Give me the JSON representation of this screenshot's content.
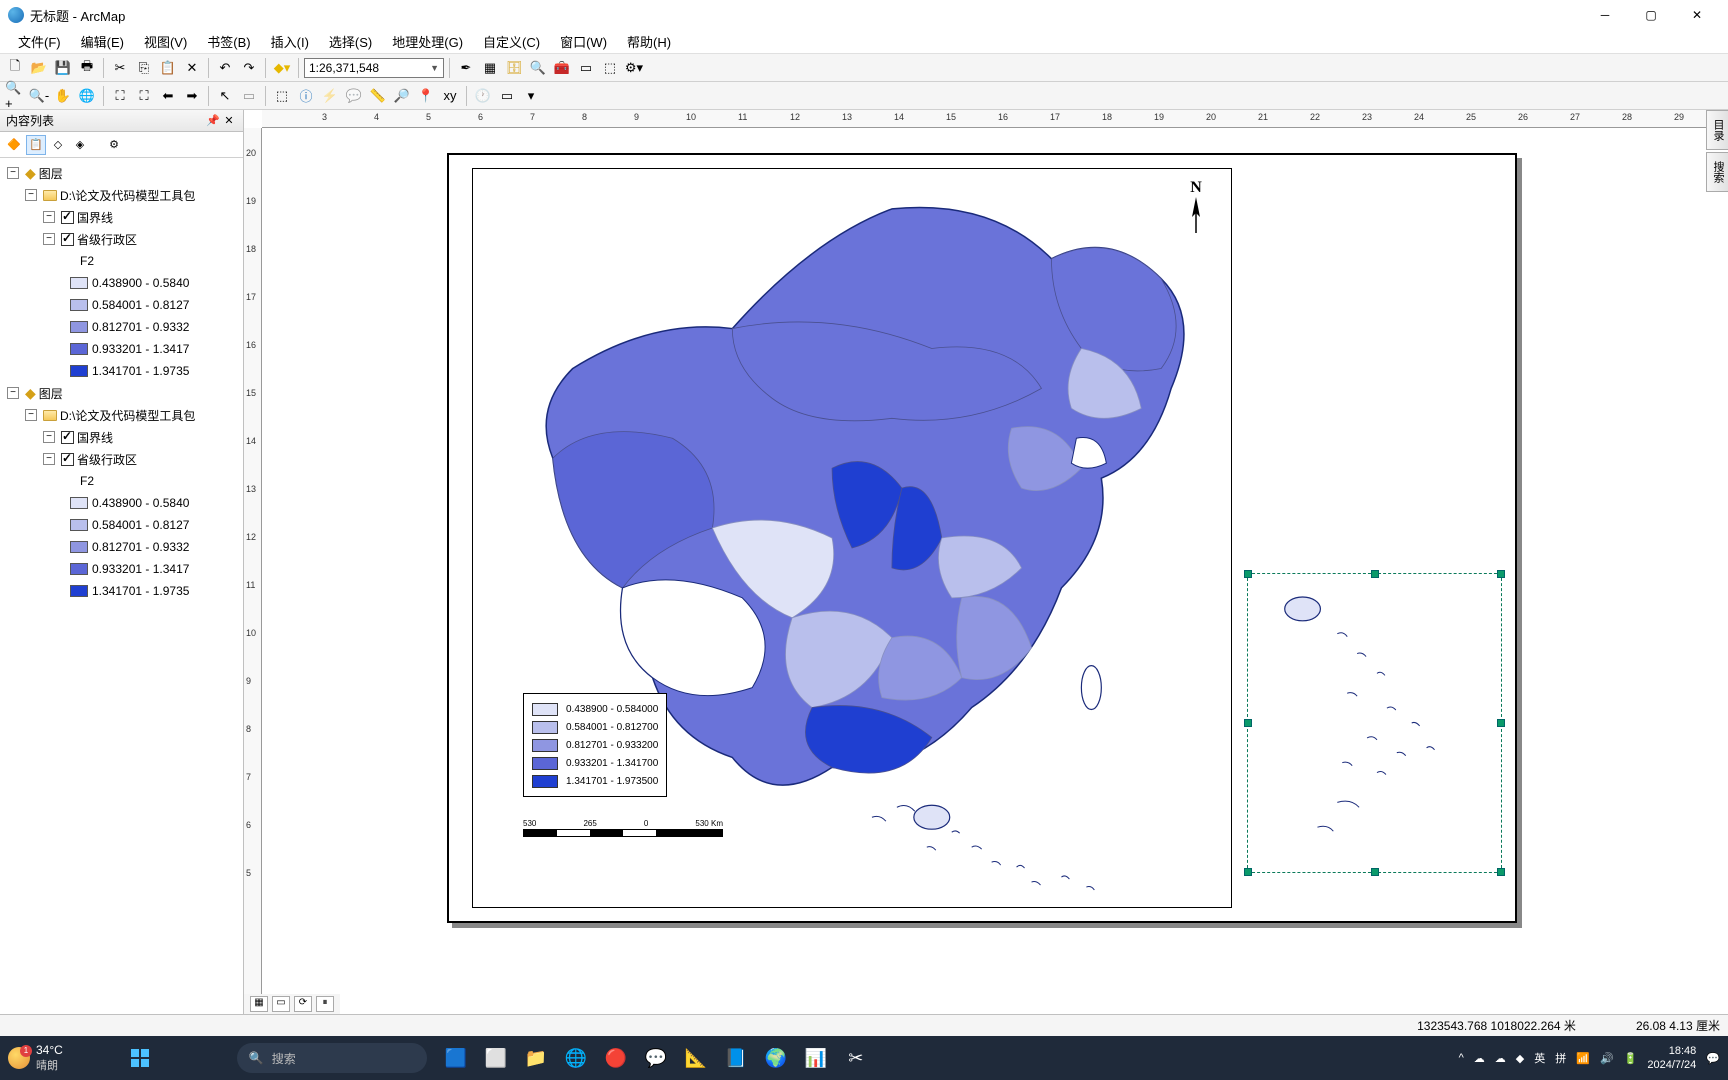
{
  "window": {
    "title": "无标题 - ArcMap"
  },
  "menu": {
    "file": "文件(F)",
    "edit": "编辑(E)",
    "view": "视图(V)",
    "bookmarks": "书签(B)",
    "insert": "插入(I)",
    "select": "选择(S)",
    "geoproc": "地理处理(G)",
    "customize": "自定义(C)",
    "window": "窗口(W)",
    "help": "帮助(H)"
  },
  "toolbar": {
    "scale": "1:26,371,548"
  },
  "toc": {
    "title": "内容列表",
    "groups": [
      {
        "group_label": "图层",
        "dataframe": "D:\\论文及代码模型工具包",
        "layers": [
          {
            "name": "国界线",
            "checked": true
          },
          {
            "name": "省级行政区",
            "checked": true,
            "field": "F2",
            "classes": [
              {
                "color": "#dfe3f7",
                "label": "0.438900 - 0.5840"
              },
              {
                "color": "#b9bfec",
                "label": "0.584001 - 0.8127"
              },
              {
                "color": "#8f96e1",
                "label": "0.812701 - 0.9332"
              },
              {
                "color": "#5b66d6",
                "label": "0.933201 - 1.3417"
              },
              {
                "color": "#1f3fd1",
                "label": "1.341701 - 1.9735"
              }
            ]
          }
        ]
      },
      {
        "group_label": "图层",
        "dataframe": "D:\\论文及代码模型工具包",
        "layers": [
          {
            "name": "国界线",
            "checked": true
          },
          {
            "name": "省级行政区",
            "checked": true,
            "field": "F2",
            "classes": [
              {
                "color": "#dfe3f7",
                "label": "0.438900 - 0.5840"
              },
              {
                "color": "#b9bfec",
                "label": "0.584001 - 0.8127"
              },
              {
                "color": "#8f96e1",
                "label": "0.812701 - 0.9332"
              },
              {
                "color": "#5b66d6",
                "label": "0.933201 - 1.3417"
              },
              {
                "color": "#1f3fd1",
                "label": "1.341701 - 1.9735"
              }
            ]
          }
        ]
      }
    ]
  },
  "legend": {
    "rows": [
      {
        "color": "#dfe3f7",
        "label": "0.438900 - 0.584000"
      },
      {
        "color": "#b9bfec",
        "label": "0.584001 - 0.812700"
      },
      {
        "color": "#8f96e1",
        "label": "0.812701 - 0.933200"
      },
      {
        "color": "#5b66d6",
        "label": "0.933201 - 1.341700"
      },
      {
        "color": "#1f3fd1",
        "label": "1.341701 - 1.973500"
      }
    ]
  },
  "north": {
    "label": "N"
  },
  "scalebar": {
    "l0": "530",
    "l1": "265",
    "l2": "0",
    "l3": "530 Km"
  },
  "status": {
    "coords": "1323543.768  1018022.264 米",
    "page": "26.08  4.13 厘米"
  },
  "side": {
    "catalog": "目录",
    "search": "搜索"
  },
  "taskbar": {
    "temp": "34°C",
    "weather": "晴朗",
    "search_ph": "搜索",
    "ime_lang": "英",
    "ime_mode": "拼",
    "time": "18:48",
    "date": "2024/7/24"
  },
  "ruler_h": [
    "3",
    "4",
    "5",
    "6",
    "7",
    "8",
    "9",
    "10",
    "11",
    "12",
    "13",
    "14",
    "15",
    "16",
    "17",
    "18",
    "19",
    "20",
    "21",
    "22",
    "23",
    "24",
    "25",
    "26",
    "27",
    "28",
    "29"
  ],
  "ruler_v": [
    "20",
    "19",
    "18",
    "17",
    "16",
    "15",
    "14",
    "13",
    "12",
    "11",
    "10",
    "9",
    "8",
    "7",
    "6",
    "5"
  ]
}
